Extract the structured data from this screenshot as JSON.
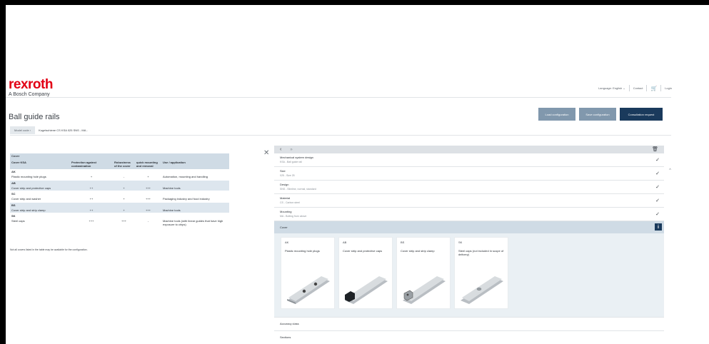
{
  "brand": {
    "name": "rexroth",
    "tagline": "A Bosch Company"
  },
  "topnav": {
    "language": "Language: English ⌄",
    "contact": "Contact",
    "login": "Login"
  },
  "page": {
    "title": "Ball guide rails"
  },
  "buttons": {
    "load": "Load configuration",
    "save": "Save configuration",
    "consult": "Consultation request"
  },
  "model_code": {
    "label": "Model code ‹",
    "value": "Kugelschiene CS KSA 025 SNS - MA -"
  },
  "cover_table": {
    "title": "Cover",
    "columns": [
      "Cover KSA",
      "Protection against contamination",
      "Robustness of the cover",
      "quick mounting and removal",
      "Use / application"
    ],
    "rows": [
      {
        "code": "AK",
        "name": "Plastic mounting hole plugs",
        "protection": "+",
        "robustness": "-",
        "mounting": "+",
        "use": "Automation, mounting and handling"
      },
      {
        "code": "AB",
        "name": "Cover strip and protective caps",
        "protection": "++",
        "robustness": "+",
        "mounting": "+++",
        "use": "Machine tools"
      },
      {
        "code": "SC",
        "name": "Cover strip and washer",
        "protection": "++",
        "robustness": "+",
        "mounting": "+++",
        "use": "Packaging industry and food industry"
      },
      {
        "code": "BS",
        "name": "Cover strip and strip clamp",
        "protection": "++",
        "robustness": "+",
        "mounting": "+++",
        "use": "Machine tools"
      },
      {
        "code": "SK",
        "name": "Steel caps",
        "protection": "+++",
        "robustness": "+++",
        "mounting": "-",
        "use": "Machine tools (with linear guides that have high exposure to chips)"
      }
    ],
    "note": "Not all covers listed in the table may be available for the configuration."
  },
  "config": {
    "steps": [
      {
        "title": "Mechanical system design",
        "value": "KSA - Ball guide rail"
      },
      {
        "title": "Size",
        "value": "025 - Size 25"
      },
      {
        "title": "Design",
        "value": "SNS - Slimline, normal, standard"
      },
      {
        "title": "Material",
        "value": "CS - Carbon steel"
      },
      {
        "title": "Mounting",
        "value": "MA - Bolting from above"
      }
    ],
    "cover": {
      "label": "Cover",
      "options": [
        {
          "code": "AK",
          "name": "Plastic mounting hole plugs"
        },
        {
          "code": "AB",
          "name": "Cover strip and protective caps"
        },
        {
          "code": "BS",
          "name": "Cover strip and strip clamp"
        },
        {
          "code": "SK",
          "name": "Steel caps (not included in scope of delivery)"
        }
      ]
    },
    "after": [
      "Accuracy class",
      "Sections"
    ]
  },
  "colors": {
    "brand_red": "#e20015",
    "accent_dark": "#1a3a5c",
    "button_grey": "#8198ad"
  }
}
